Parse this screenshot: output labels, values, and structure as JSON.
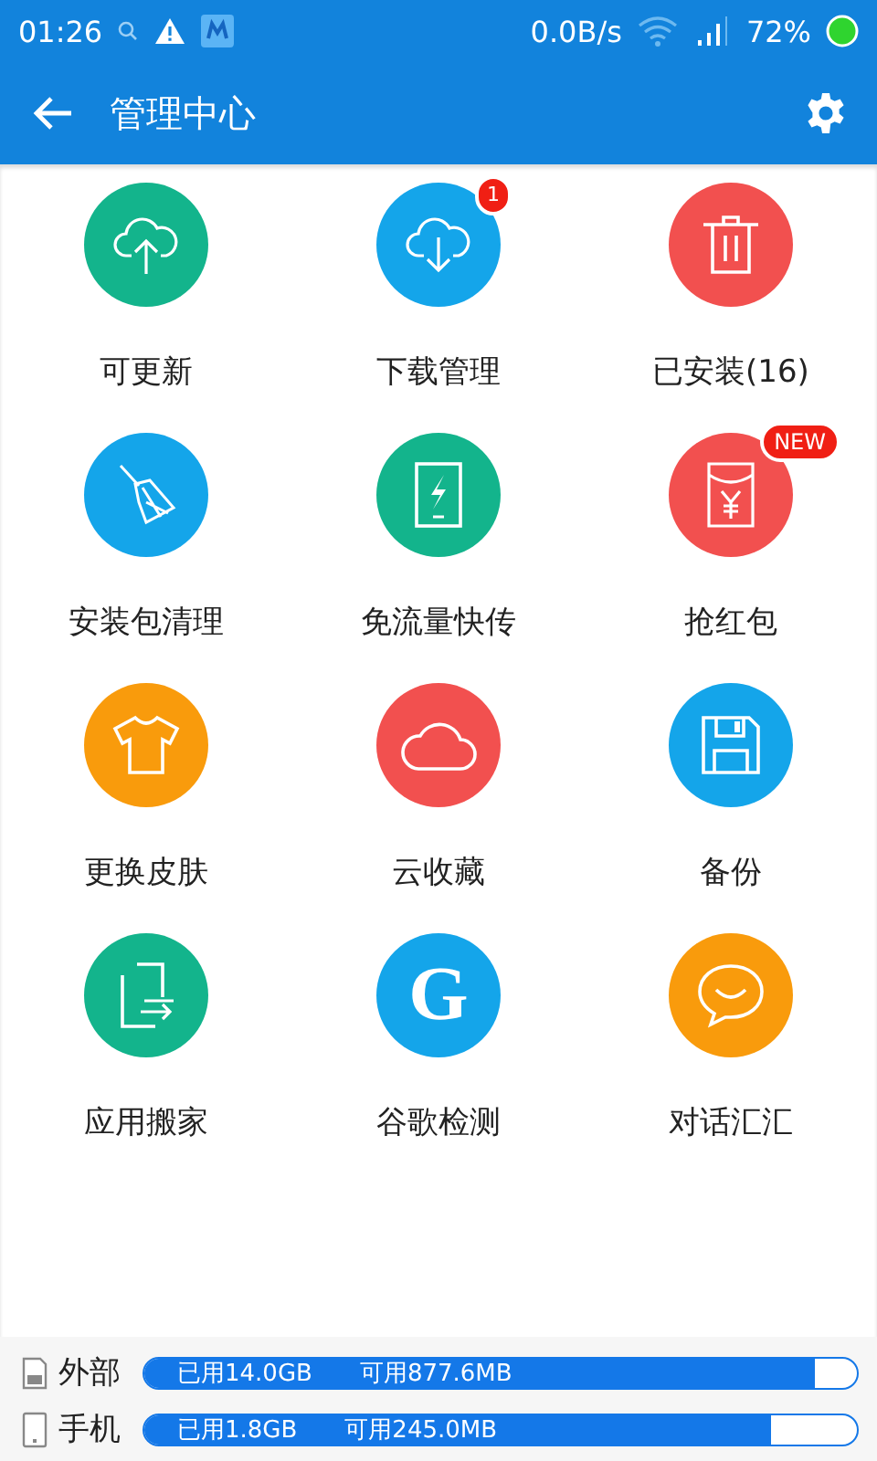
{
  "status_bar": {
    "time": "01:26",
    "speed": "0.0B/s",
    "battery": "72%"
  },
  "app_bar": {
    "title": "管理中心"
  },
  "tiles": [
    {
      "label": "可更新",
      "kind": "upload",
      "color": "#13b48c"
    },
    {
      "label": "下载管理",
      "kind": "download",
      "color": "#14a5ea",
      "badge": "1"
    },
    {
      "label": "已安装(16)",
      "kind": "trash",
      "color": "#f2504f"
    },
    {
      "label": "安装包清理",
      "kind": "broom",
      "color": "#14a5ea"
    },
    {
      "label": "免流量快传",
      "kind": "bolt",
      "color": "#13b48c"
    },
    {
      "label": "抢红包",
      "kind": "envelope",
      "color": "#f2504f",
      "badge": "NEW"
    },
    {
      "label": "更换皮肤",
      "kind": "shirt",
      "color": "#f99b0c"
    },
    {
      "label": "云收藏",
      "kind": "cloud",
      "color": "#f2504f"
    },
    {
      "label": "备份",
      "kind": "floppy",
      "color": "#14a5ea"
    },
    {
      "label": "应用搬家",
      "kind": "transfer",
      "color": "#13b48c"
    },
    {
      "label": "谷歌检测",
      "kind": "letter",
      "glyph": "G",
      "color": "#14a5ea"
    },
    {
      "label": "对话汇汇",
      "kind": "chat",
      "color": "#f99b0c"
    }
  ],
  "storage": [
    {
      "kind": "sd",
      "name": "外部",
      "used": "已用14.0GB",
      "free": "可用877.6MB",
      "level": 0.94
    },
    {
      "kind": "phone",
      "name": "手机",
      "used": "已用1.8GB",
      "free": "可用245.0MB",
      "level": 0.88
    }
  ]
}
